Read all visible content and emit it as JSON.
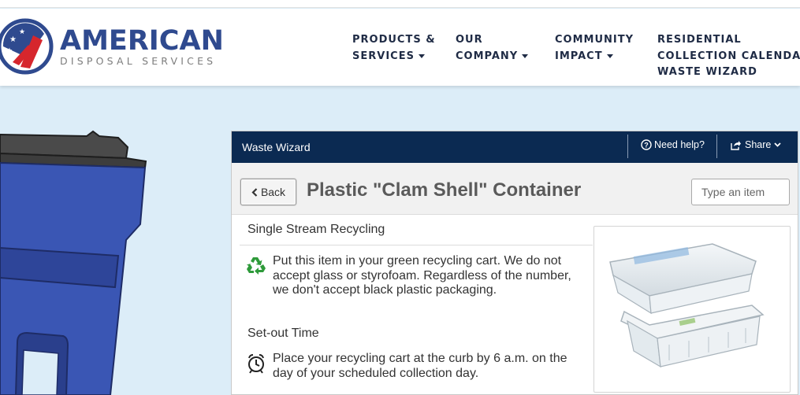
{
  "brand": {
    "name": "AMERICAN",
    "tagline": "DISPOSAL SERVICES"
  },
  "nav": {
    "items": [
      {
        "line1": "PRODUCTS &",
        "line2": "SERVICES"
      },
      {
        "line1": "OUR",
        "line2": "COMPANY"
      },
      {
        "line1": "COMMUNITY",
        "line2": "IMPACT"
      },
      {
        "line1": "RESIDENTIAL",
        "line2": "COLLECTION CALENDAR &",
        "line3": "WASTE WIZARD"
      }
    ]
  },
  "widget": {
    "title": "Waste Wizard",
    "help_label": "Need help?",
    "share_label": "Share",
    "back_label": "Back",
    "item_title": "Plastic \"Clam Shell\" Container",
    "search_placeholder": "Type an item",
    "sections": [
      {
        "title": "Single Stream Recycling",
        "icon": "recycle-icon",
        "text": "Put this item in your green recycling cart. We do not accept glass or styrofoam. Regardless of the number, we don't accept black plastic packaging."
      },
      {
        "title": "Set-out Time",
        "icon": "alarm-clock-icon",
        "text": "Place your recycling cart at the curb by 6 a.m. on the day of your scheduled collection day."
      }
    ]
  },
  "colors": {
    "brand_blue": "#2f4a8f",
    "widget_bar": "#0b2a52",
    "page_bg": "#dcedf8",
    "recycle_green": "#2e9a3a",
    "cart_blue": "#3a56b4"
  }
}
